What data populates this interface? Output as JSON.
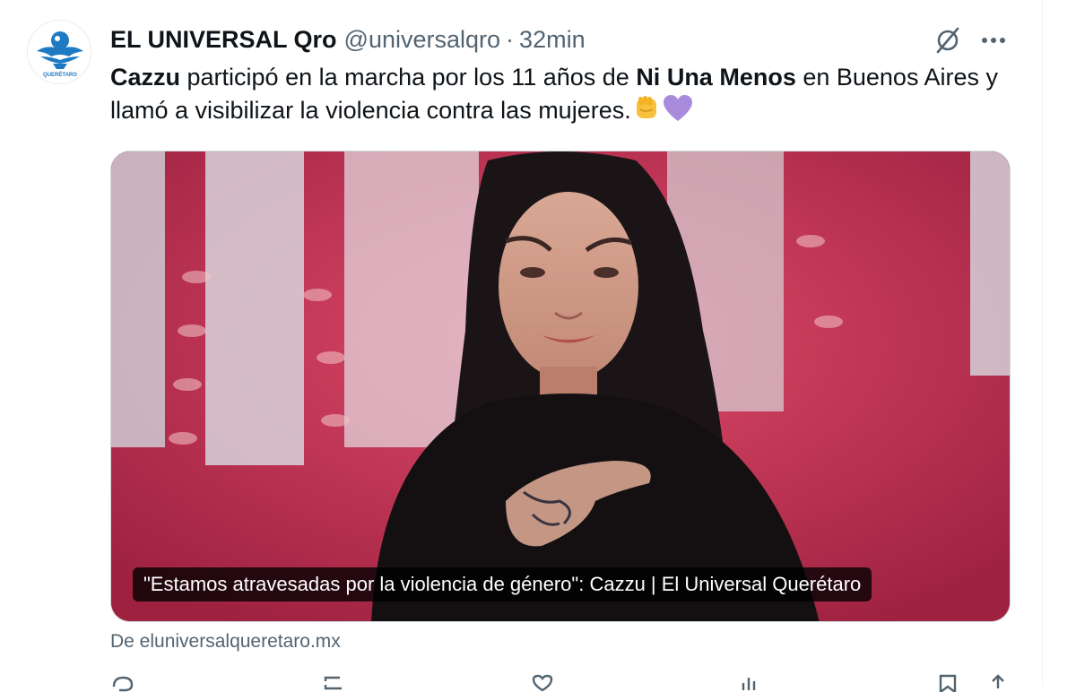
{
  "tweet": {
    "display_name": "EL UNIVERSAL Qro",
    "handle": "@universalqro",
    "separator": "·",
    "time": "32min",
    "text_part1_bold": "Cazzu",
    "text_part2": " participó en la marcha por los 11 años de ",
    "text_part3_bold": "Ni Una Menos",
    "text_part4": " en Buenos Aires y llamó a visibilizar la violencia contra las mujeres.",
    "emojis": [
      "raised-fist-emoji",
      "purple-heart-emoji"
    ]
  },
  "avatar": {
    "label": "QUERÉTARO",
    "icon": "eagle-logo-icon",
    "brand_color": "#1f7ac4"
  },
  "card": {
    "title": "\"Estamos atravesadas por la violencia de género\": Cazzu | El Universal Querétaro",
    "source": "De eluniversalqueretaro.mx",
    "image_desc": "photo"
  },
  "icons": {
    "grok": "grok-icon",
    "more": "more-icon"
  },
  "actions": [
    "reply-icon",
    "retweet-icon",
    "like-icon",
    "views-icon",
    "bookmark-icon",
    "share-icon"
  ]
}
